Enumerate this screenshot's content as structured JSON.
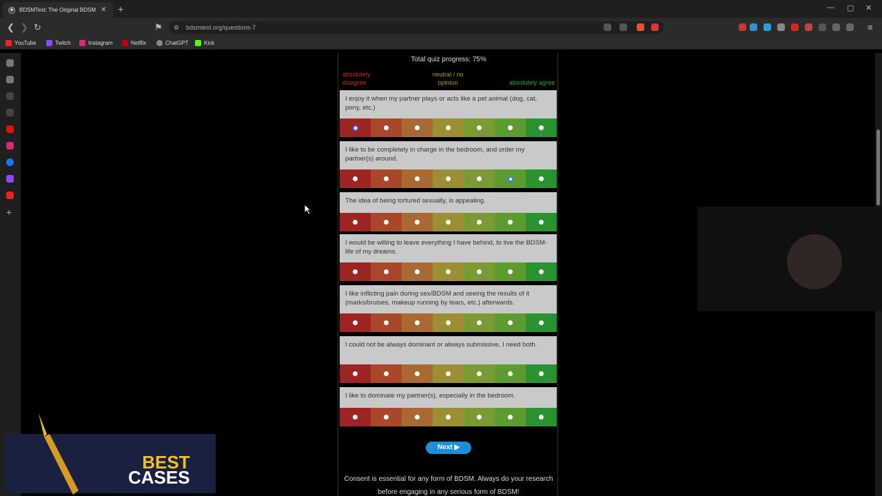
{
  "browser": {
    "tab_title": "BDSMTest: The Original BDSM &",
    "url": "bdsmtest.org/questions-7",
    "bookmarks": [
      "YouTube",
      "Twitch",
      "Instagram",
      "Netflix",
      "ChatGPT",
      "Kick"
    ]
  },
  "quiz": {
    "progress_text": "Total quiz progress: 75%",
    "legend": {
      "left": "absolutely disagree",
      "middle": "neutral / no opinion",
      "right": "absolutely agree"
    },
    "scale_colors": [
      "#9e2424",
      "#a8472a",
      "#a86a32",
      "#9c8e34",
      "#7a9a34",
      "#5b9b2f",
      "#2a9230"
    ],
    "questions": [
      {
        "text": "I enjoy it when my partner plays or acts like a pet animal (dog, cat, pony, etc.)",
        "selected": 0
      },
      {
        "text": "I like to be completely in charge in the bedroom, and order my partner(s) around.",
        "selected": 5
      },
      {
        "text": "The idea of being tortured sexually, is appealing.",
        "selected": null
      },
      {
        "text": "I would be willing to leave everything I have behind, to live the BDSM-life of my dreams.",
        "selected": null
      },
      {
        "text": "I like inflicting pain during sex/BDSM and seeing the results of it (marks/bruises, makeup running by tears, etc.) afterwards.",
        "selected": null
      },
      {
        "text": "I could not be always dominant or always submissive, I need both.",
        "selected": null
      },
      {
        "text": "I like to dominate my partner(s), especially in the bedroom.",
        "selected": null
      }
    ],
    "next_label": "Next ▶",
    "consent_text": "Consent is essential for any form of BDSM. Always do your research before engaging in any serious form of BDSM!"
  },
  "overlay": {
    "banner_line1": "BEST",
    "banner_line2": "CASES"
  }
}
